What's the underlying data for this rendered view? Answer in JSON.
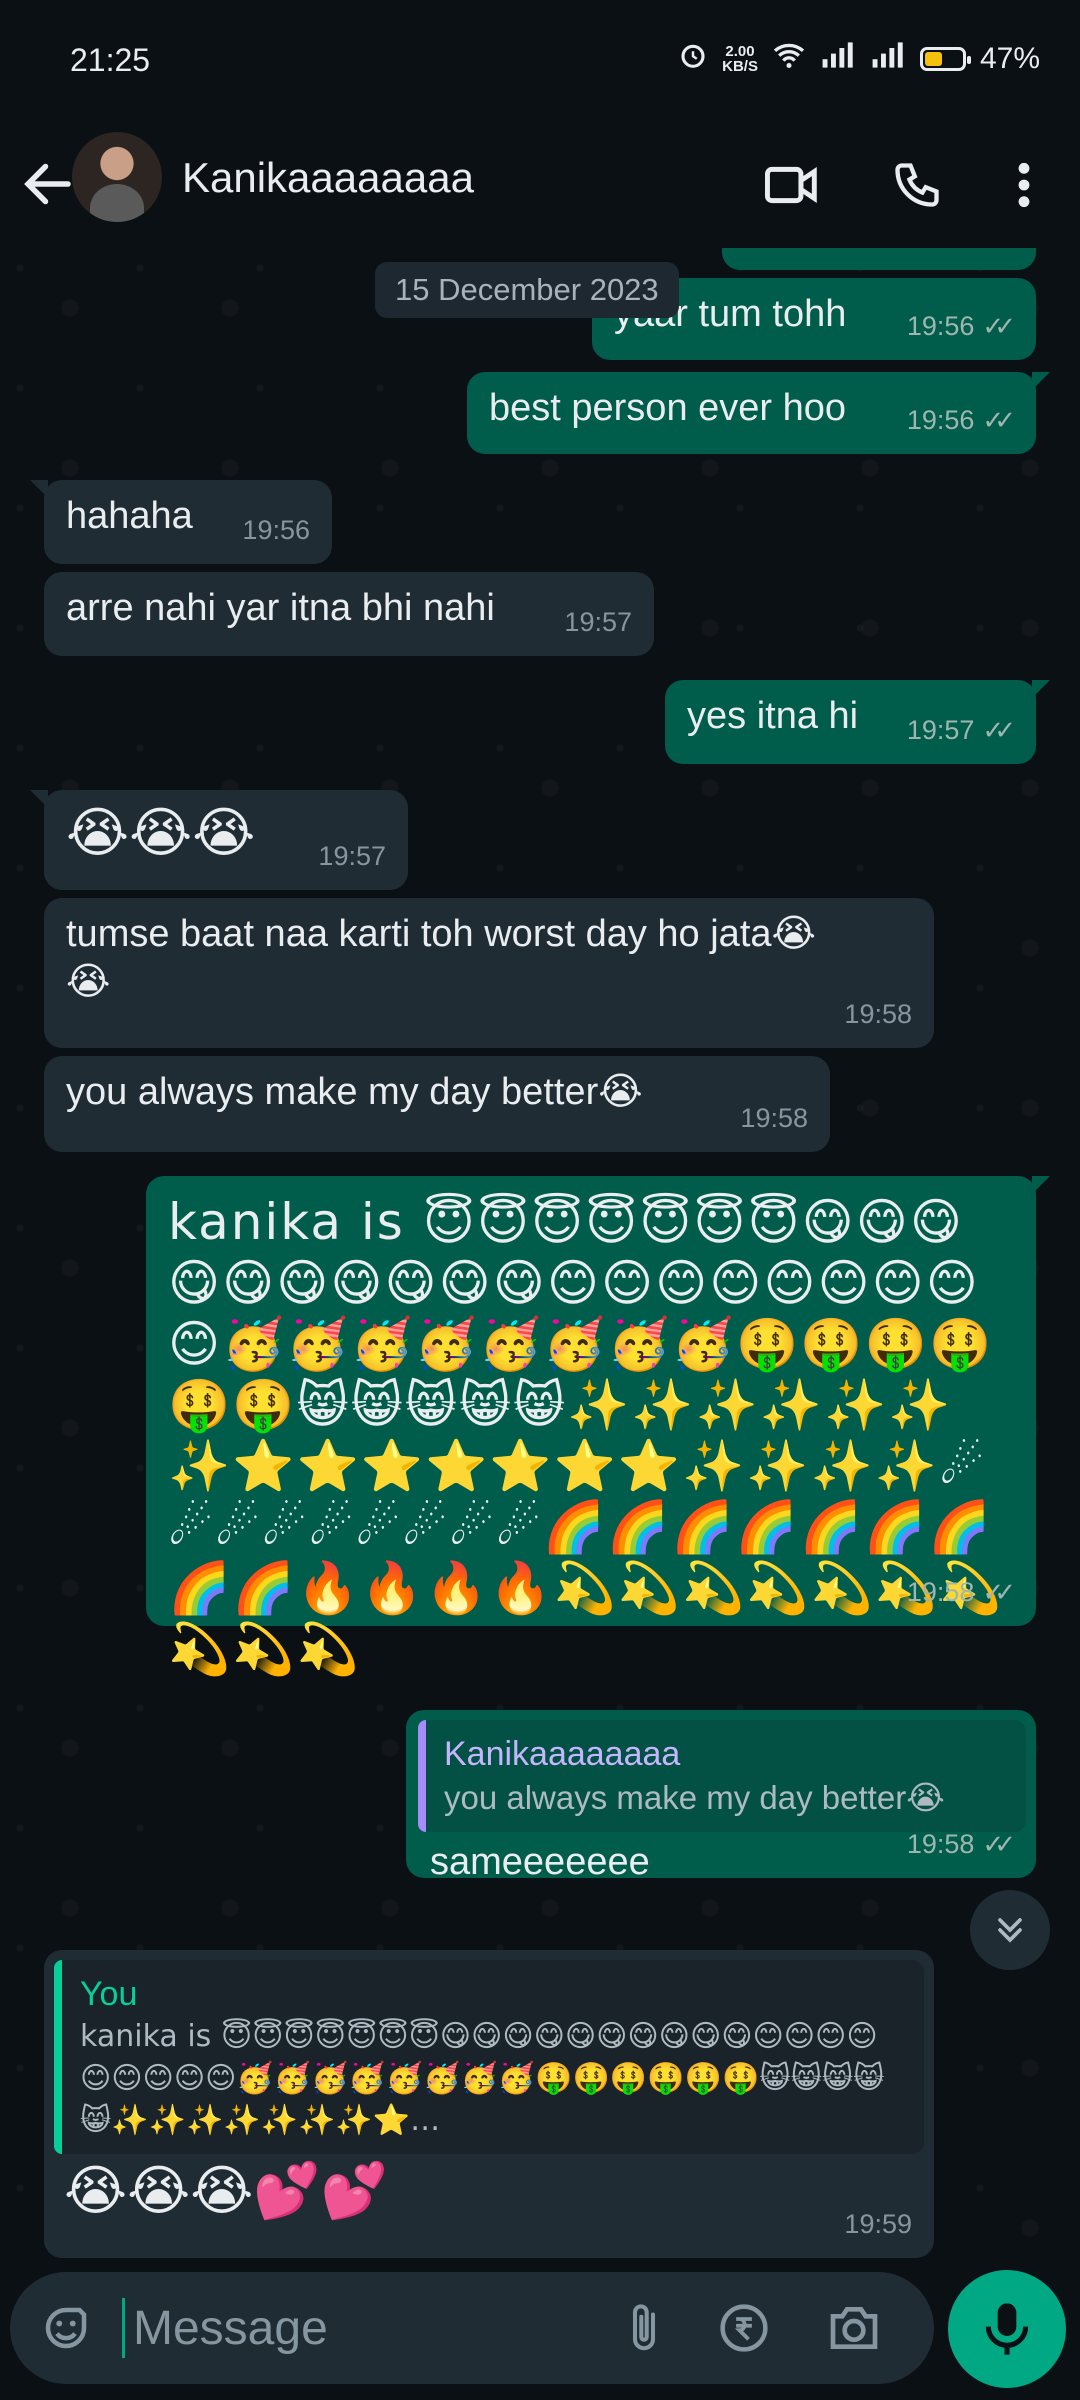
{
  "status": {
    "time": "21:25",
    "speed_value": "2.00",
    "speed_unit": "KB/S",
    "battery_pct": "47%",
    "battery_level": 0.47
  },
  "header": {
    "contact_name": "Kanikaaaaaaaa"
  },
  "chat": {
    "date": "15 December 2023",
    "messages": [
      {
        "text": "yaar tum tohh",
        "time": "19:56"
      },
      {
        "text": "best person ever hoo",
        "time": "19:56"
      },
      {
        "text": "hahaha",
        "time": "19:56"
      },
      {
        "text": "arre nahi yar itna bhi nahi",
        "time": "19:57"
      },
      {
        "text": "yes itna hi",
        "time": "19:57"
      },
      {
        "text": "😭😭😭",
        "time": "19:57"
      },
      {
        "text": "tumse baat naa karti toh worst day ho jata😭",
        "text2": "😭",
        "time": "19:58"
      },
      {
        "text": "you always make my day better😭",
        "time": "19:58"
      },
      {
        "text": "kanika is 😇😇😇😇😇😇😇😋😋😋😋",
        "text2": "😋😋😋😋😋😋😊😊😊😊😊😊😊😊😊🥳🥳🥳🥳🥳🥳🥳🥳🤑🤑🤑🤑🤑🤑😸😸😸😸😸✨✨✨✨✨✨✨⭐⭐⭐⭐⭐⭐⭐✨✨✨✨☄☄☄☄☄☄☄☄☄🌈🌈🌈🌈🌈🌈🌈🌈🌈🔥🔥🔥🔥💫💫💫💫💫💫💫💫💫💫",
        "time": "19:58"
      },
      {
        "quote_name": "Kanikaaaaaaaa",
        "quote_text": "you always make my day better😭",
        "text": "sameeeeeee",
        "time": "19:58"
      },
      {
        "quote_name": "You",
        "quote_text": "kanika is 😇😇😇😇😇😇😇😋😋😋😋😋😋😋😋😋😋😊😊😊😊😊😊😊😊😊🥳🥳🥳🥳🥳🥳🥳🥳🤑🤑🤑🤑🤑🤑😸😸😸😸😸✨✨✨✨✨✨✨⭐…",
        "text": "😭😭😭💕💕",
        "time": "19:59"
      }
    ]
  },
  "composer": {
    "placeholder": "Message"
  },
  "icons": {
    "back": "back-arrow-icon",
    "video": "video-call-icon",
    "call": "phone-icon",
    "menu": "more-options-icon",
    "emoji": "emoji-icon",
    "attach": "attach-icon",
    "payment": "rupee-icon",
    "camera": "camera-icon",
    "mic": "mic-icon",
    "scroll": "scroll-down-icon",
    "read": "double-check-icon"
  },
  "colors": {
    "outgoing": "#005c4b",
    "incoming": "#1f2c34",
    "accent": "#00a884",
    "background": "#0b1014"
  }
}
